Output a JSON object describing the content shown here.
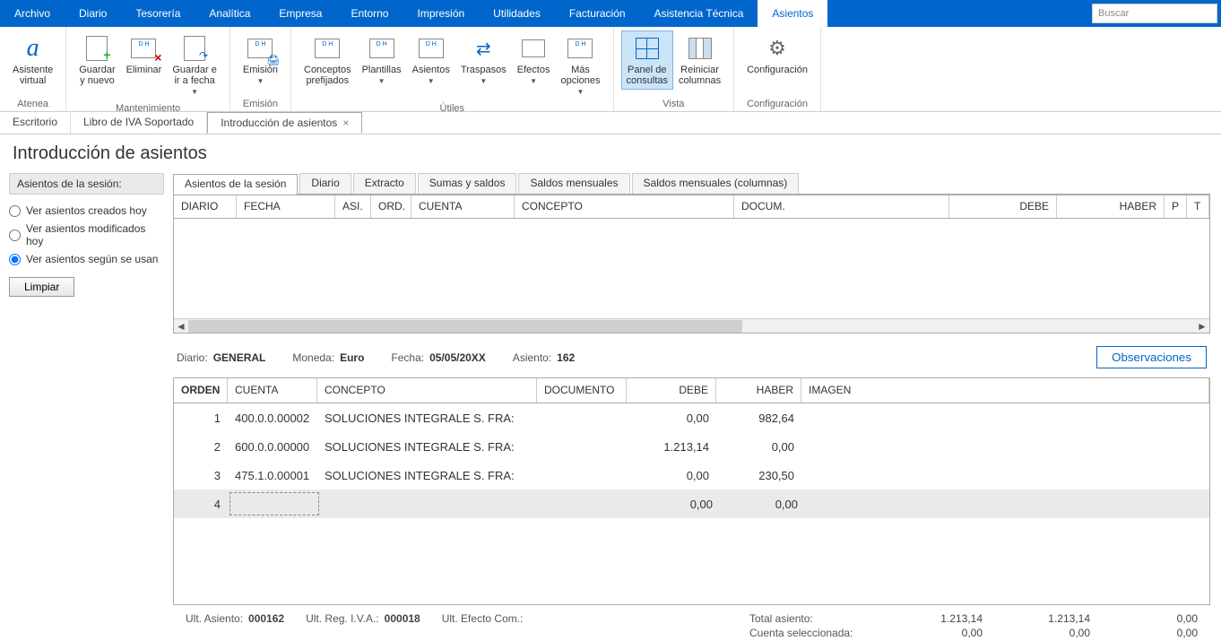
{
  "menu": {
    "items": [
      "Archivo",
      "Diario",
      "Tesorería",
      "Analítica",
      "Empresa",
      "Entorno",
      "Impresión",
      "Utilidades",
      "Facturación",
      "Asistencia Técnica",
      "Asientos"
    ],
    "active": "Asientos",
    "search_placeholder": "Buscar"
  },
  "ribbon": {
    "groups": [
      {
        "label": "Atenea",
        "buttons": [
          {
            "name": "asistente-virtual",
            "label": "Asistente\nvirtual"
          }
        ]
      },
      {
        "label": "Mantenimiento",
        "buttons": [
          {
            "name": "guardar-nuevo",
            "label": "Guardar\ny nuevo"
          },
          {
            "name": "eliminar",
            "label": "Eliminar"
          },
          {
            "name": "guardar-ir-fecha",
            "label": "Guardar e\nir a fecha",
            "dropdown": true
          }
        ]
      },
      {
        "label": "Emisión",
        "buttons": [
          {
            "name": "emision",
            "label": "Emisión",
            "dropdown": true
          }
        ]
      },
      {
        "label": "Útiles",
        "buttons": [
          {
            "name": "conceptos-prefijados",
            "label": "Conceptos\nprefijados"
          },
          {
            "name": "plantillas",
            "label": "Plantillas",
            "dropdown": true
          },
          {
            "name": "asientos",
            "label": "Asientos",
            "dropdown": true
          },
          {
            "name": "traspasos",
            "label": "Traspasos",
            "dropdown": true
          },
          {
            "name": "efectos",
            "label": "Efectos",
            "dropdown": true
          },
          {
            "name": "mas-opciones",
            "label": "Más\nopciones",
            "dropdown": true
          }
        ]
      },
      {
        "label": "Vista",
        "buttons": [
          {
            "name": "panel-consultas",
            "label": "Panel de\nconsultas",
            "active": true
          },
          {
            "name": "reiniciar-columnas",
            "label": "Reiniciar\ncolumnas"
          }
        ]
      },
      {
        "label": "Configuración",
        "buttons": [
          {
            "name": "configuracion",
            "label": "Configuración"
          }
        ]
      }
    ]
  },
  "doc_tabs": [
    {
      "label": "Escritorio",
      "active": false
    },
    {
      "label": "Libro de IVA Soportado",
      "active": false
    },
    {
      "label": "Introducción de asientos",
      "active": true,
      "closable": true
    }
  ],
  "page_title": "Introducción de asientos",
  "side": {
    "header": "Asientos de la sesión:",
    "options": [
      {
        "label": "Ver asientos creados hoy",
        "checked": false
      },
      {
        "label": "Ver asientos modificados hoy",
        "checked": false
      },
      {
        "label": "Ver asientos según se usan",
        "checked": true
      }
    ],
    "clear_btn": "Limpiar"
  },
  "inner_tabs": [
    "Asientos de la sesión",
    "Diario",
    "Extracto",
    "Sumas y saldos",
    "Saldos mensuales",
    "Saldos mensuales (columnas)"
  ],
  "grid1_headers": [
    "DIARIO",
    "FECHA",
    "ASI.",
    "ORD.",
    "CUENTA",
    "CONCEPTO",
    "DOCUM.",
    "DEBE",
    "HABER",
    "P",
    "T"
  ],
  "info": {
    "diario_lbl": "Diario:",
    "diario_val": "GENERAL",
    "moneda_lbl": "Moneda:",
    "moneda_val": "Euro",
    "fecha_lbl": "Fecha:",
    "fecha_val": "05/05/20XX",
    "asiento_lbl": "Asiento:",
    "asiento_val": "162",
    "obs_btn": "Observaciones"
  },
  "grid2": {
    "headers": {
      "orden": "ORDEN",
      "cuenta": "CUENTA",
      "concepto": "CONCEPTO",
      "documento": "DOCUMENTO",
      "debe": "DEBE",
      "haber": "HABER",
      "imagen": "IMAGEN"
    },
    "rows": [
      {
        "orden": "1",
        "cuenta": "400.0.0.00002",
        "concepto": "SOLUCIONES INTEGRALE S. FRA:",
        "documento": "",
        "debe": "0,00",
        "haber": "982,64"
      },
      {
        "orden": "2",
        "cuenta": "600.0.0.00000",
        "concepto": "SOLUCIONES INTEGRALE S. FRA:",
        "documento": "",
        "debe": "1.213,14",
        "haber": "0,00"
      },
      {
        "orden": "3",
        "cuenta": "475.1.0.00001",
        "concepto": "SOLUCIONES INTEGRALE S. FRA:",
        "documento": "",
        "debe": "0,00",
        "haber": "230,50"
      },
      {
        "orden": "4",
        "cuenta": "",
        "concepto": "",
        "documento": "",
        "debe": "0,00",
        "haber": "0,00",
        "active": true
      }
    ]
  },
  "footer": {
    "ult_asiento_lbl": "Ult. Asiento:",
    "ult_asiento_val": "000162",
    "ult_reg_iva_lbl": "Ult. Reg. I.V.A.:",
    "ult_reg_iva_val": "000018",
    "ult_efecto_lbl": "Ult. Efecto Com.:",
    "ult_efecto_val": "",
    "total_asiento_lbl": "Total asiento:",
    "cuenta_sel_lbl": "Cuenta seleccionada:",
    "total_debe": "1.213,14",
    "total_haber": "1.213,14",
    "total_diff": "0,00",
    "sel_debe": "0,00",
    "sel_haber": "0,00",
    "sel_diff": "0,00"
  }
}
